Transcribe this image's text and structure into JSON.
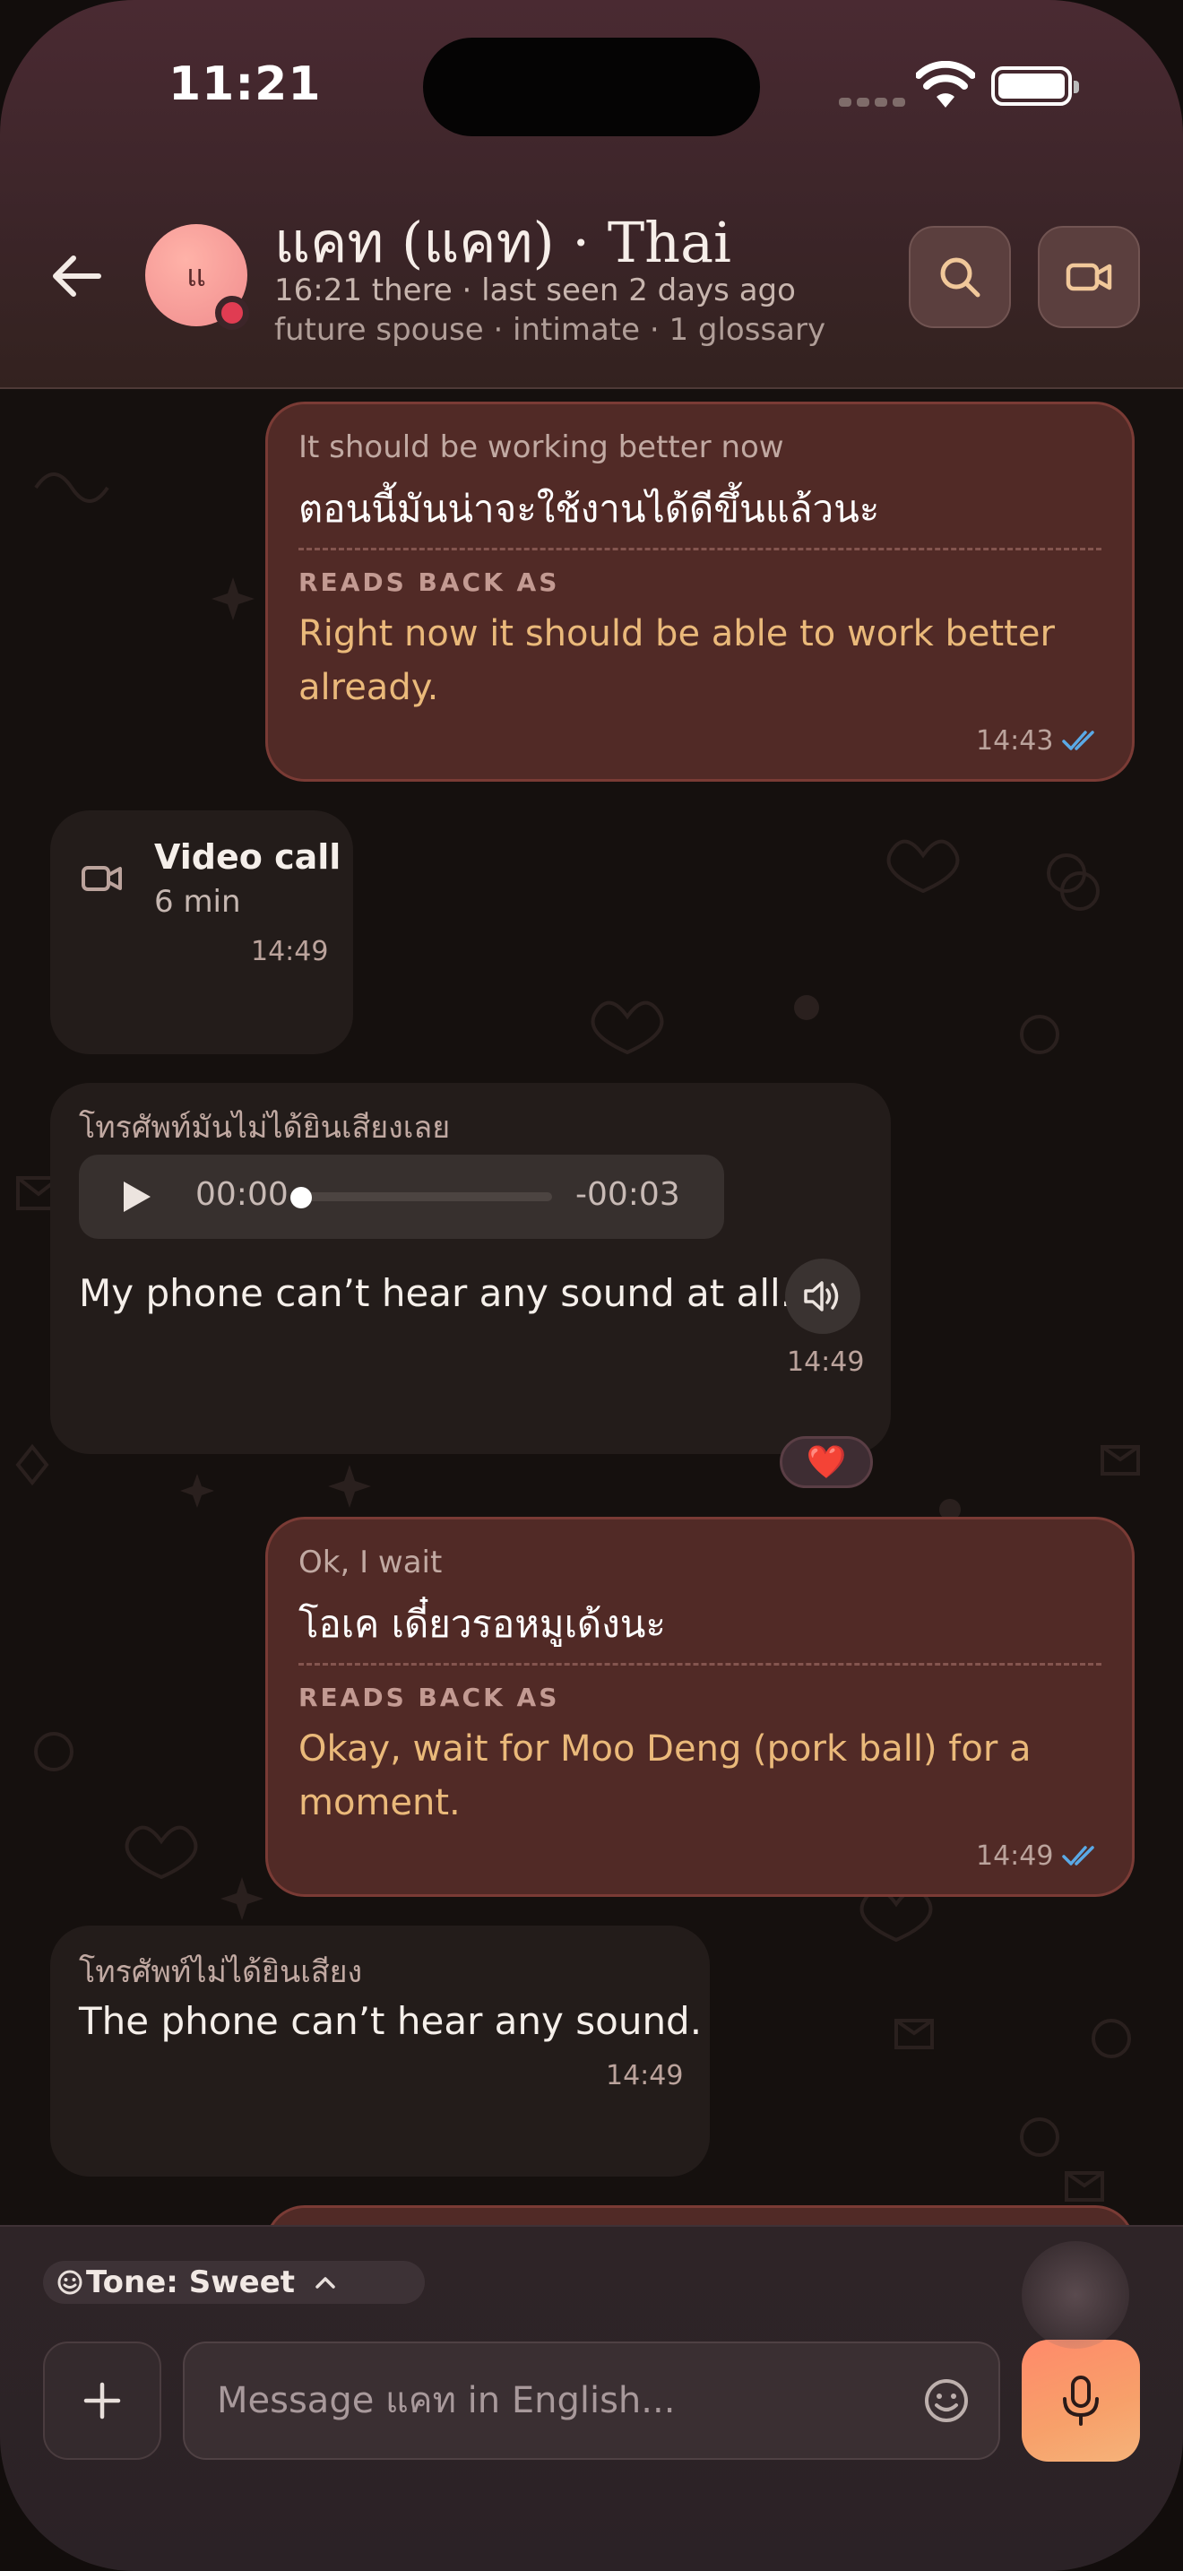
{
  "status_bar": {
    "time": "11:21"
  },
  "header": {
    "avatar_initials": "แ",
    "contact_name": "แคท (แคท) · Thai",
    "local_time_status": "16:21 there · last seen 2 days ago",
    "relationship_line": "future spouse · intimate · 1 glossary"
  },
  "messages": [
    {
      "direction": "out",
      "source_text": "It should be working better now",
      "translation": "ตอนนี้มันน่าจะใช้งานได้ดีขึ้นแล้วนะ",
      "reads_back_label": "READS BACK AS",
      "reads_back_line1": "Right now it should be able to work better",
      "reads_back_line2": "already.",
      "time": "14:43",
      "read": true
    },
    {
      "direction": "in",
      "type": "call",
      "title": "Video call",
      "duration": "6 min",
      "time": "14:49"
    },
    {
      "direction": "in",
      "type": "voice",
      "original": "โทรศัพท์มันไม่ได้ยินเสียงเลย",
      "audio_elapsed": "00:00",
      "audio_remaining": "-00:03",
      "audio_progress": 0.0,
      "translation": "My phone can’t hear any sound at all.",
      "time": "14:49",
      "reaction": "❤️"
    },
    {
      "direction": "out",
      "source_text": "Ok, I wait",
      "translation": "โอเค เดี๋ยวรอหมูเด้งนะ",
      "reads_back_label": "READS BACK AS",
      "reads_back_line1": "Okay, wait for Moo Deng (pork ball) for a",
      "reads_back_line2": "moment.",
      "time": "14:49",
      "read": true
    },
    {
      "direction": "in",
      "type": "text",
      "original": "โทรศัพท์ไม่ได้ยินเสียง",
      "translation": "The phone can’t hear any sound.",
      "time": "14:49"
    }
  ],
  "composer": {
    "tone_label": "Tone: Sweet",
    "placeholder": "Message แคท in English..."
  },
  "colors": {
    "outgoing_bubble": "#512a26",
    "incoming_bubble": "#231c1a",
    "reads_back_text": "#eab97a",
    "accent_mic": "#ff8a6a",
    "read_ticks": "#5aa9e6"
  },
  "icons": [
    "back-arrow-icon",
    "search-icon",
    "video-camera-icon",
    "play-icon",
    "speaker-icon",
    "read-ticks-icon",
    "smiley-tone-icon",
    "chevron-up-icon",
    "plus-icon",
    "emoji-icon",
    "microphone-icon",
    "wifi-icon",
    "battery-icon"
  ]
}
